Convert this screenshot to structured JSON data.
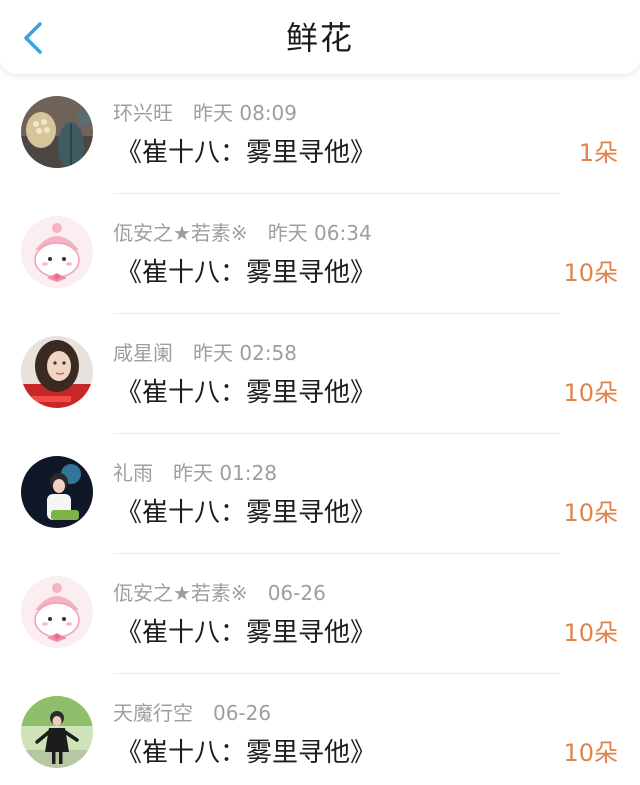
{
  "header": {
    "title": "鲜花",
    "back_icon": "chevron-left-icon",
    "accent_color": "#3aa3e0"
  },
  "records": [
    {
      "name": "环兴旺",
      "time": "昨天 08:09",
      "message": "《崔十八：雾里寻他》",
      "count": "1朵",
      "avatar": "cactus-avatar"
    },
    {
      "name": "佤安之★若素※",
      "time": "昨天 06:34",
      "message": "《崔十八：雾里寻他》",
      "count": "10朵",
      "avatar": "pink-cartoon-avatar"
    },
    {
      "name": "咸星阑",
      "time": "昨天 02:58",
      "message": "《崔十八：雾里寻他》",
      "count": "10朵",
      "avatar": "girl-photo-avatar"
    },
    {
      "name": "礼雨",
      "time": "昨天 01:28",
      "message": "《崔十八：雾里寻他》",
      "count": "10朵",
      "avatar": "couple-photo-avatar"
    },
    {
      "name": "佤安之★若素※",
      "time": "06-26",
      "message": "《崔十八：雾里寻他》",
      "count": "10朵",
      "avatar": "pink-cartoon-avatar"
    },
    {
      "name": "天魔行空",
      "time": "06-26",
      "message": "《崔十八：雾里寻他》",
      "count": "10朵",
      "avatar": "person-outdoor-avatar"
    }
  ],
  "colors": {
    "count": "#e0834a",
    "meta": "#9e9e9e",
    "message": "#1e1e1e"
  }
}
